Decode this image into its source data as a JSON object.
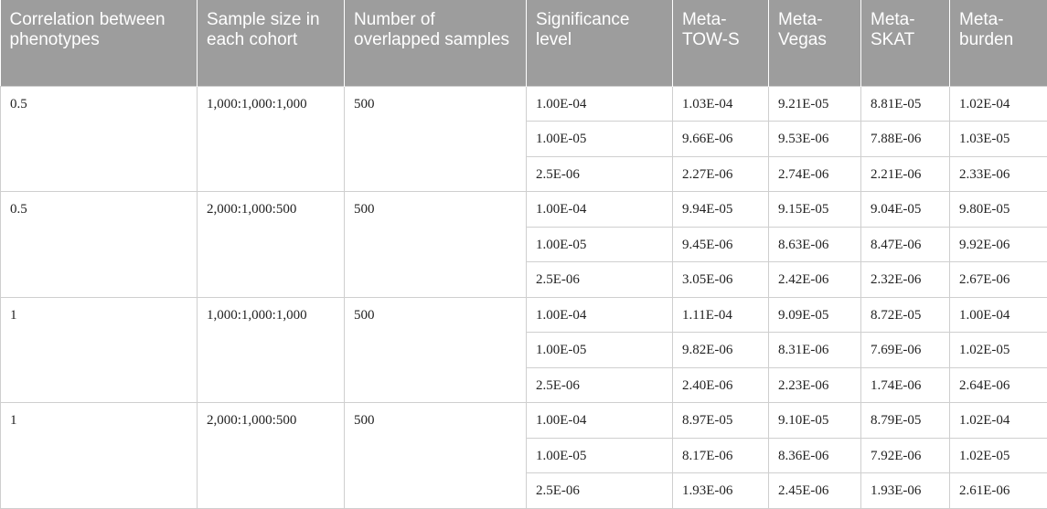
{
  "headers": [
    "Correlation between phenotypes",
    "Sample size in each cohort",
    "Number of overlapped samples",
    "Significance level",
    "Meta-TOW-S",
    "Meta-Vegas",
    "Meta-SKAT",
    "Meta-burden"
  ],
  "groups": [
    {
      "correlation": "0.5",
      "sample_size": "1,000:1,000:1,000",
      "overlapped": "500",
      "rows": [
        {
          "sig": "1.00E-04",
          "tows": "1.03E-04",
          "vegas": "9.21E-05",
          "skat": "8.81E-05",
          "burden": "1.02E-04"
        },
        {
          "sig": "1.00E-05",
          "tows": "9.66E-06",
          "vegas": "9.53E-06",
          "skat": "7.88E-06",
          "burden": "1.03E-05"
        },
        {
          "sig": "2.5E-06",
          "tows": "2.27E-06",
          "vegas": "2.74E-06",
          "skat": "2.21E-06",
          "burden": "2.33E-06"
        }
      ]
    },
    {
      "correlation": "0.5",
      "sample_size": "2,000:1,000:500",
      "overlapped": "500",
      "rows": [
        {
          "sig": "1.00E-04",
          "tows": "9.94E-05",
          "vegas": "9.15E-05",
          "skat": "9.04E-05",
          "burden": "9.80E-05"
        },
        {
          "sig": "1.00E-05",
          "tows": "9.45E-06",
          "vegas": "8.63E-06",
          "skat": "8.47E-06",
          "burden": "9.92E-06"
        },
        {
          "sig": "2.5E-06",
          "tows": "3.05E-06",
          "vegas": "2.42E-06",
          "skat": "2.32E-06",
          "burden": "2.67E-06"
        }
      ]
    },
    {
      "correlation": "1",
      "sample_size": "1,000:1,000:1,000",
      "overlapped": "500",
      "rows": [
        {
          "sig": "1.00E-04",
          "tows": "1.11E-04",
          "vegas": "9.09E-05",
          "skat": "8.72E-05",
          "burden": "1.00E-04"
        },
        {
          "sig": "1.00E-05",
          "tows": "9.82E-06",
          "vegas": "8.31E-06",
          "skat": "7.69E-06",
          "burden": "1.02E-05"
        },
        {
          "sig": "2.5E-06",
          "tows": "2.40E-06",
          "vegas": "2.23E-06",
          "skat": "1.74E-06",
          "burden": "2.64E-06"
        }
      ]
    },
    {
      "correlation": "1",
      "sample_size": "2,000:1,000:500",
      "overlapped": "500",
      "rows": [
        {
          "sig": "1.00E-04",
          "tows": "8.97E-05",
          "vegas": "9.10E-05",
          "skat": "8.79E-05",
          "burden": "1.02E-04"
        },
        {
          "sig": "1.00E-05",
          "tows": "8.17E-06",
          "vegas": "8.36E-06",
          "skat": "7.92E-06",
          "burden": "1.02E-05"
        },
        {
          "sig": "2.5E-06",
          "tows": "1.93E-06",
          "vegas": "2.45E-06",
          "skat": "1.93E-06",
          "burden": "2.61E-06"
        }
      ]
    }
  ]
}
